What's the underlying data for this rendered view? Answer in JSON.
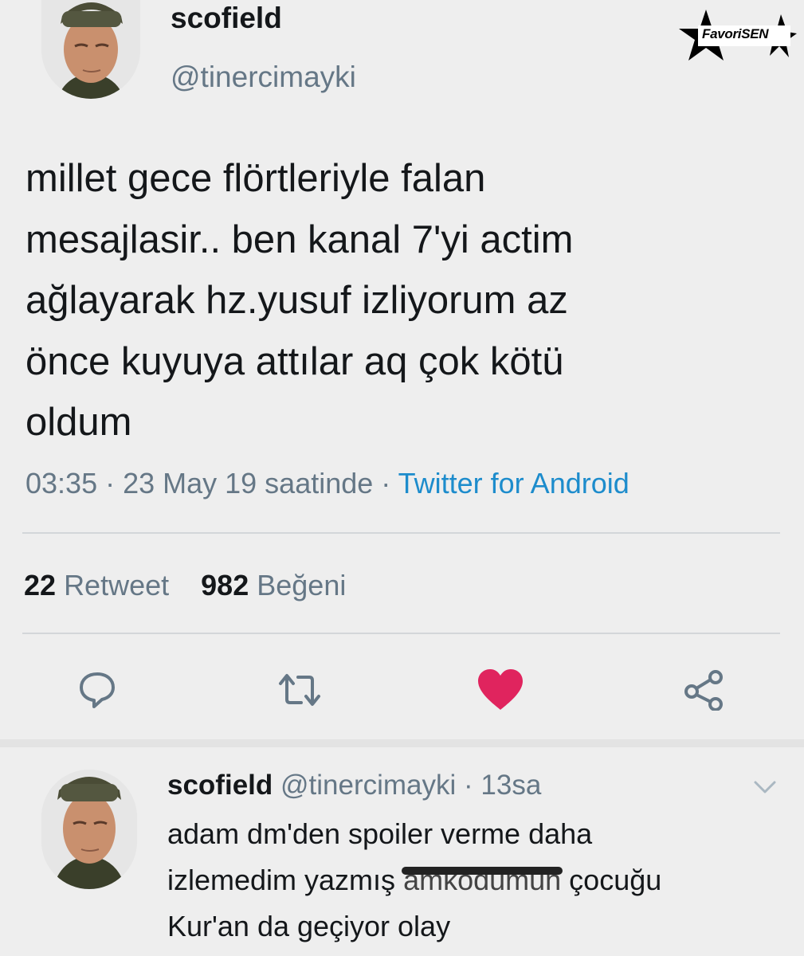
{
  "badge": {
    "text": "FavoriSEN"
  },
  "tweet": {
    "name": "scofield",
    "handle": "@tinercimayki",
    "lines": [
      "millet gece flörtleriyle falan",
      "mesajlasir.. ben kanal 7'yi actim",
      "ağlayarak hz.yusuf izliyorum az",
      "önce kuyuya attılar aq çok kötü",
      "oldum"
    ],
    "time": "03:35 · 23 May 19 saatinde · ",
    "source": "Twitter for Android",
    "retweet_count": "22",
    "retweet_label": "Retweet",
    "like_count": "982",
    "like_label": "Beğeni"
  },
  "actions": {
    "icons": [
      "reply-icon",
      "retweet-icon",
      "heart-icon",
      "share-icon"
    ],
    "like_color": "#e0245e",
    "icon_color": "#657786"
  },
  "reply": {
    "name": "scofield",
    "handle": "@tinercimayki · 13sa",
    "line1": "adam dm'den spoiler verme daha",
    "line2_pre": "izlemedim yazmış ",
    "line2_scribbled": "amkodumun",
    "line2_post": " çocuğu",
    "line3": "Kur'an da geçiyor olay"
  },
  "colors": {
    "background": "#eeeeee",
    "secondary_text": "#657786",
    "link": "#1d8ccc"
  }
}
